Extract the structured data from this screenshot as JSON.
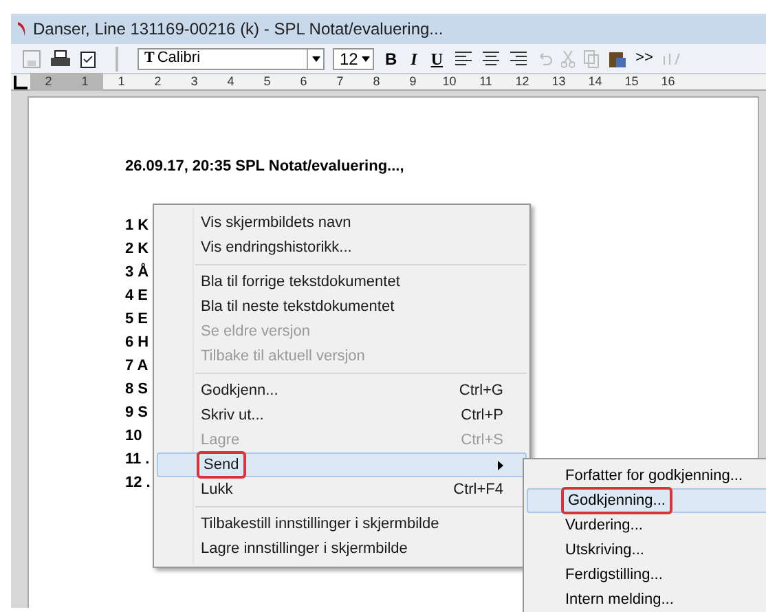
{
  "window": {
    "title": "Danser, Line 131169-00216 (k) - SPL Notat/evaluering..."
  },
  "toolbar": {
    "font": "Calibri",
    "font_glyph": "T",
    "size": "12",
    "format_buttons": [
      "B",
      "I",
      "U"
    ],
    "more": ">>"
  },
  "ruler": {
    "marks": [
      "2",
      "1",
      "1",
      "2",
      "3",
      "4",
      "5",
      "6",
      "7",
      "8",
      "9",
      "10",
      "11",
      "12",
      "13",
      "14",
      "15",
      "16"
    ]
  },
  "document": {
    "heading": "26.09.17, 20:35 SPL Notat/evaluering...,",
    "lines": [
      "1 K",
      "2 K",
      "3 Å",
      "4 E",
      "5 E",
      "6 H",
      "7 A",
      "8 S",
      "9 S",
      "10",
      "11 .",
      "12 ."
    ]
  },
  "context_menu": {
    "groups": [
      [
        {
          "label": "Vis skjermbildets navn",
          "disabled": false
        },
        {
          "label": "Vis endringshistorikk...",
          "disabled": false
        }
      ],
      [
        {
          "label": "Bla til forrige tekstdokumentet",
          "disabled": false
        },
        {
          "label": "Bla til neste tekstdokumentet",
          "disabled": false
        },
        {
          "label": "Se eldre versjon",
          "disabled": true
        },
        {
          "label": "Tilbake til aktuell versjon",
          "disabled": true
        }
      ],
      [
        {
          "label": "Godkjenn...",
          "shortcut": "Ctrl+G",
          "disabled": false
        },
        {
          "label": "Skriv ut...",
          "shortcut": "Ctrl+P",
          "disabled": false
        },
        {
          "label": "Lagre",
          "shortcut": "Ctrl+S",
          "disabled": true
        },
        {
          "label": "Send",
          "submenu": true,
          "selected": true,
          "annotated": true,
          "disabled": false
        },
        {
          "label": "Lukk",
          "shortcut": "Ctrl+F4",
          "disabled": false
        }
      ],
      [
        {
          "label": "Tilbakestill innstillinger i skjermbilde",
          "disabled": false
        },
        {
          "label": "Lagre innstillinger i skjermbilde",
          "disabled": false
        }
      ]
    ]
  },
  "submenu": {
    "items": [
      {
        "label": "Forfatter for godkjenning...",
        "selected": false,
        "annotated": false
      },
      {
        "label": "Godkjenning...",
        "selected": true,
        "annotated": true
      },
      {
        "label": "Vurdering...",
        "selected": false,
        "annotated": false
      },
      {
        "label": "Utskriving...",
        "selected": false,
        "annotated": false
      },
      {
        "label": "Ferdigstilling...",
        "selected": false,
        "annotated": false
      },
      {
        "label": "Intern melding...",
        "selected": false,
        "annotated": false
      }
    ]
  }
}
